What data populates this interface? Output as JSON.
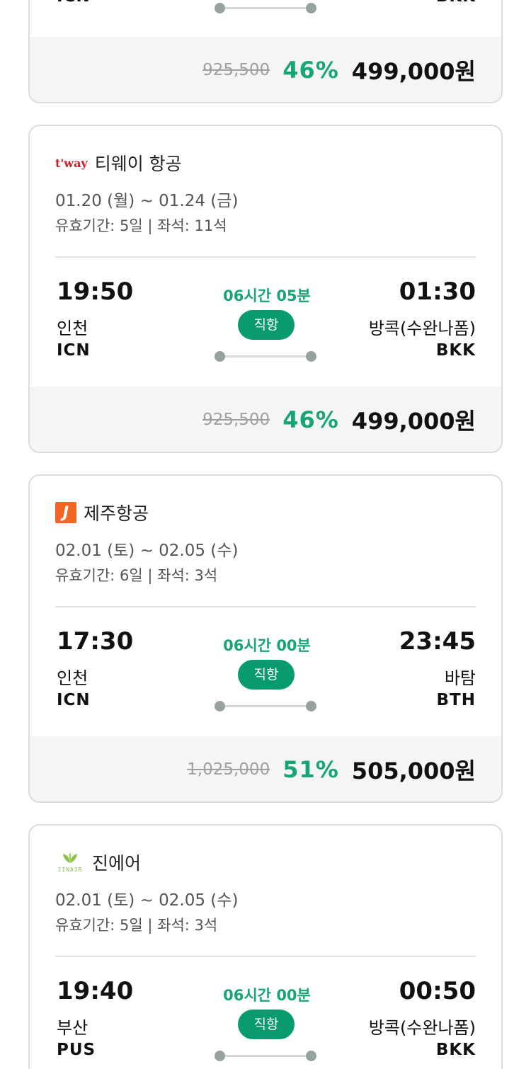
{
  "partial_card": {
    "dest_code": "BKK",
    "orig_code": "ICN",
    "original_price": "925,500",
    "discount": "46%",
    "price": "499,000원"
  },
  "flights": [
    {
      "airline": "티웨이 항공",
      "logo_icon": "tway-logo-icon",
      "logo_text": "t'way",
      "dates": "01.20 (월) ~ 01.24 (금)",
      "validity": "유효기간: 5일 | 좌석: 11석",
      "dep_time": "19:50",
      "dep_city": "인천",
      "dep_code": "ICN",
      "duration": "06시간 05분",
      "type": "직항",
      "arr_time": "01:30",
      "arr_city": "방콕(수완나폼)",
      "arr_code": "BKK",
      "original_price": "925,500",
      "discount": "46%",
      "price": "499,000원"
    },
    {
      "airline": "제주항공",
      "logo_icon": "jejuair-logo-icon",
      "logo_text": "J",
      "dates": "02.01 (토) ~ 02.05 (수)",
      "validity": "유효기간: 6일 | 좌석: 3석",
      "dep_time": "17:30",
      "dep_city": "인천",
      "dep_code": "ICN",
      "duration": "06시간 00분",
      "type": "직항",
      "arr_time": "23:45",
      "arr_city": "바탐",
      "arr_code": "BTH",
      "original_price": "1,025,000",
      "discount": "51%",
      "price": "505,000원"
    },
    {
      "airline": "진에어",
      "logo_icon": "jinair-logo-icon",
      "logo_text": "JINAIR",
      "dates": "02.01 (토) ~ 02.05 (수)",
      "validity": "유효기간: 5일 | 좌석: 3석",
      "dep_time": "19:40",
      "dep_city": "부산",
      "dep_code": "PUS",
      "duration": "06시간 00분",
      "type": "직항",
      "arr_time": "00:50",
      "arr_city": "방콕(수완나폼)",
      "arr_code": "BKK"
    }
  ],
  "colors": {
    "accent_green": "#17a673",
    "pill_green": "#0a9a70",
    "tway_red": "#c8202a",
    "jeju_orange": "#f26522",
    "jinair_green": "#8bc34a"
  }
}
